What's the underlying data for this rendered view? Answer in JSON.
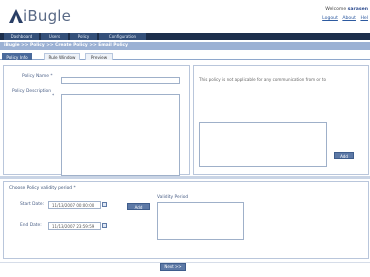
{
  "header": {
    "app_name": "iBugle",
    "welcome_prefix": "Welcome ",
    "welcome_user": "sarasen",
    "links": [
      "Logout",
      "About",
      "Hel"
    ]
  },
  "nav": {
    "tabs": [
      "Dashboard",
      "Users",
      "Policy",
      "Configuration"
    ]
  },
  "breadcrumb": "iBugle >> Policy >> Create Policy >> Email Policy",
  "subtabs": [
    "Policy Info",
    "Rule Window",
    "Preview"
  ],
  "policy": {
    "name_label": "Policy Name *",
    "name_value": "",
    "description_label": "Policy Description",
    "description_required_mark": "*",
    "description_value": ""
  },
  "applicability": {
    "text": "This policy is not applicable for any communication from or to",
    "add_button": "Add"
  },
  "validity": {
    "section_label": "Choose Policy validity period *",
    "start_label": "Start Date:",
    "start_value": "11/13/2007 00:00:00",
    "end_label": "End Date:",
    "end_value": "11/13/2007 23:59:59",
    "add_button": "Add",
    "period_label": "Validity Period"
  },
  "footer": {
    "next_button": "Next >>"
  },
  "colors": {
    "nav_bg": "#1d2f4c",
    "crumb_bg": "#9bb1d4",
    "accent": "#4a6a9b"
  }
}
